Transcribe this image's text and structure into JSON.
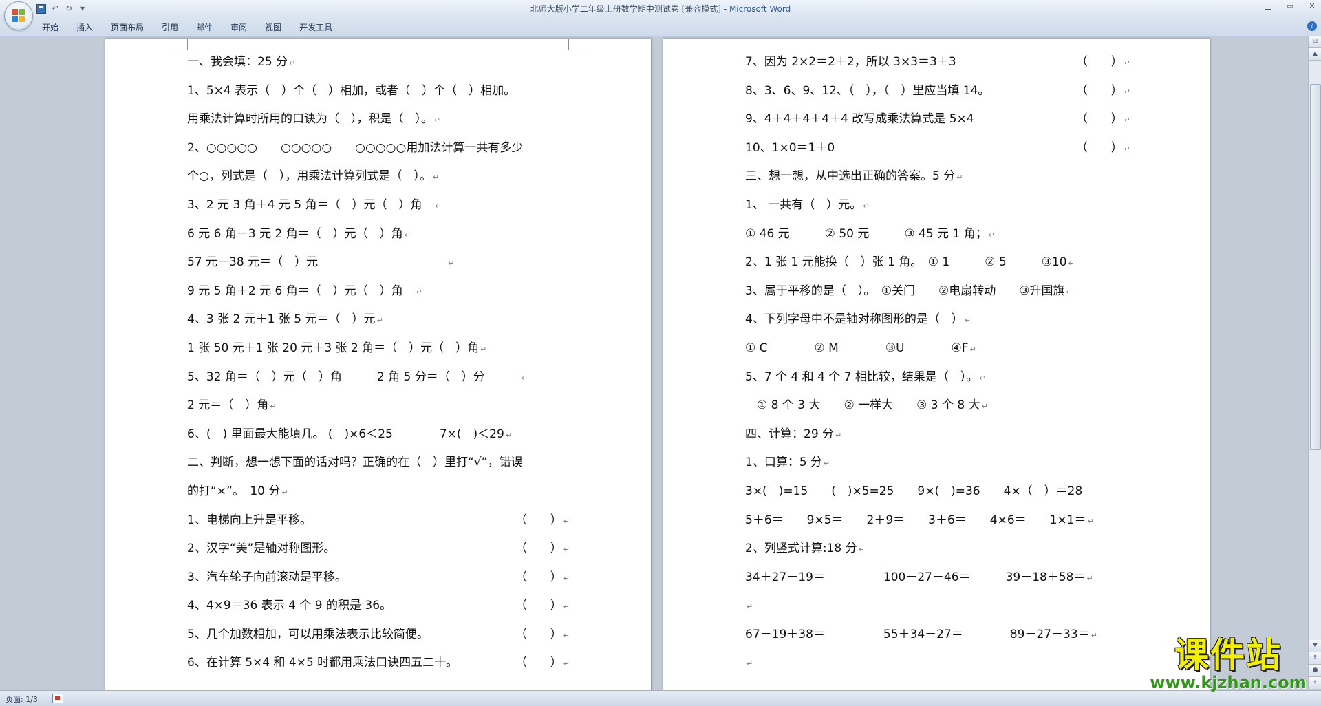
{
  "window": {
    "title": "北师大版小学二年级上册数学期中测试卷 [兼容模式]",
    "app_name": "Microsoft Word",
    "title_separator": " - "
  },
  "ribbon": {
    "tabs": [
      "开始",
      "插入",
      "页面布局",
      "引用",
      "邮件",
      "审阅",
      "视图",
      "开发工具"
    ]
  },
  "paragraph_mark": "↵",
  "left_page": {
    "lines": [
      {
        "t": "一、我会填：25 分"
      },
      {
        "t": "1、5×4 表示（　）个（　）相加，或者（　）个（　）相加。",
        "nomark": true
      },
      {
        "t": "用乘法计算时所用的口诀为（　），积是（　）。"
      },
      {
        "t": "2、○○○○○　　○○○○○　　○○○○○用加法计算一共有多少",
        "nomark": true
      },
      {
        "t": "个○，列式是（　），用乘法计算列式是（　）。"
      },
      {
        "t": "3、2 元 3 角＋4 元 5 角＝（　）元（　）角　"
      },
      {
        "t": " 6 元 6 角－3 元 2 角＝（　）元（　）角"
      },
      {
        "t": "57 元－38 元＝（　）元　　　　　　　　　　　"
      },
      {
        "t": " 9 元 5 角＋2 元 6 角＝（　）元（　）角　"
      },
      {
        "t": "4、3 张 2 元＋1 张 5 元＝（　）元"
      },
      {
        "t": "1 张 50 元＋1 张 20 元＋3 张 2 角＝（　）元（　）角"
      },
      {
        "t": "5、32 角＝（　）元（　）角　　　2 角 5 分＝（　）分　　　"
      },
      {
        "t": " 2 元＝（　）角"
      },
      {
        "t": "6、(　) 里面最大能填几。 (　)×6＜25　　　　7×(　)＜29"
      },
      {
        "t": "二、判断，想一想下面的话对吗？正确的在（　）里打“√”，错误",
        "nomark": true
      },
      {
        "t": "的打“×”。　10 分"
      },
      {
        "t": "1、电梯向上升是平移。",
        "r": "（　　）"
      },
      {
        "t": "2、汉字“美”是轴对称图形。",
        "r": "（　　）"
      },
      {
        "t": "3、汽车轮子向前滚动是平移。",
        "r": "（　　）"
      },
      {
        "t": "4、4×9＝36 表示 4 个 9 的积是 36。",
        "r": "（　　）"
      },
      {
        "t": "5、几个加数相加，可以用乘法表示比较简便。",
        "r": "（　　）"
      },
      {
        "t": "6、在计算 5×4 和 4×5 时都用乘法口诀四五二十。",
        "r": "（　　）"
      }
    ]
  },
  "right_page": {
    "lines": [
      {
        "t": "7、因为 2×2＝2＋2，所以 3×3＝3＋3",
        "r": "（　　）"
      },
      {
        "t": "8、3、6、9、12、（　），（　）里应当填 14。",
        "r": "（　　）"
      },
      {
        "t": "9、4＋4＋4＋4＋4 改写成乘法算式是 5×4",
        "r": "（　　）"
      },
      {
        "t": "10、1×0＝1＋0",
        "r": "（　　）"
      },
      {
        "t": "三、想一想，从中选出正确的答案。5 分"
      },
      {
        "t": "1、 一共有（　）元。"
      },
      {
        "t": "① 46 元　　　② 50 元　　　③ 45 元 1 角；"
      },
      {
        "t": "2、1 张 1 元能换（　）张 1 角。　① 1　　　② 5　　　③10"
      },
      {
        "t": "3、属于平移的是（　）。　①关门　　②电扇转动　　③升国旗"
      },
      {
        "t": "4、下列字母中不是轴对称图形的是（　）"
      },
      {
        "t": "① C　　　　② M　　　　③U　　　　④F"
      },
      {
        "t": "5、7 个 4 和 4 个 7 相比较，结果是（　）。"
      },
      {
        "t": "　① 8 个 3 大　　② 一样大　　③ 3 个 8 大"
      },
      {
        "t": "四、计算：29 分"
      },
      {
        "t": "1、口算：5 分"
      },
      {
        "t": "3×(　)=15　　(　)×5=25　　9×(　)=36　　4×（　）＝28",
        "nomark": true
      },
      {
        "t": "5＋6＝　　9×5＝　　2＋9＝　　3＋6＝　　4×6＝　　1×1＝"
      },
      {
        "t": "2、列竖式计算:18 分"
      },
      {
        "t": "34＋27－19＝　　　　　100－27－46＝　　　39－18＋58＝"
      },
      {
        "t": ""
      },
      {
        "t": "67－19＋38＝　　　　　55＋34－27＝　　　　89－27－33＝"
      },
      {
        "t": ""
      }
    ]
  },
  "status": {
    "page_info": "页面: 1/3"
  },
  "watermark": {
    "main": "课件站",
    "url": "www.kjzhan.com"
  }
}
